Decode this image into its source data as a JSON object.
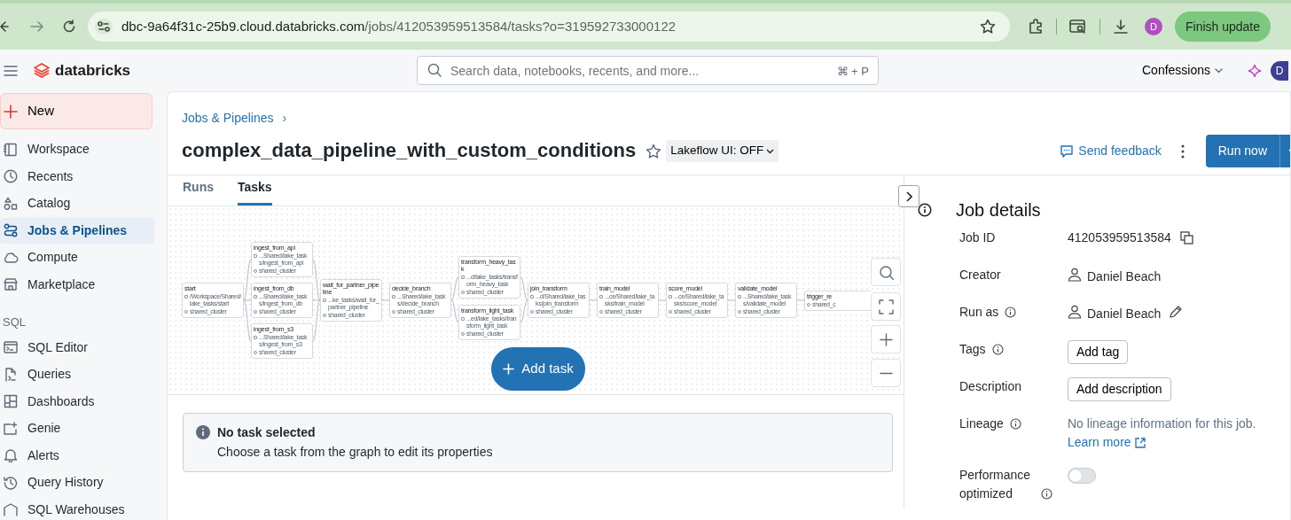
{
  "browser": {
    "url_host": "dbc-9a64f31c-25b9.cloud.databricks.com",
    "url_path": "/jobs/412053959513584/tasks?o=319592733000122",
    "profile_initial": "D",
    "update_button": "Finish update"
  },
  "header": {
    "brand": "databricks",
    "search_placeholder": "Search data, notebooks, recents, and more...",
    "shortcut": "⌘ + P",
    "workspace": "Confessions",
    "avatar_initial": "D"
  },
  "sidebar": {
    "new_button": "New",
    "items": [
      {
        "label": "Workspace",
        "selected": false
      },
      {
        "label": "Recents",
        "selected": false
      },
      {
        "label": "Catalog",
        "selected": false
      },
      {
        "label": "Jobs & Pipelines",
        "selected": true
      },
      {
        "label": "Compute",
        "selected": false
      },
      {
        "label": "Marketplace",
        "selected": false
      }
    ],
    "sql_heading": "SQL",
    "sql_items": [
      {
        "label": "SQL Editor",
        "selected": false
      },
      {
        "label": "Queries",
        "selected": false
      },
      {
        "label": "Dashboards",
        "selected": false
      },
      {
        "label": "Genie",
        "selected": false
      },
      {
        "label": "Alerts",
        "selected": false
      },
      {
        "label": "Query History",
        "selected": false
      },
      {
        "label": "SQL Warehouses",
        "selected": false
      }
    ]
  },
  "job": {
    "breadcrumb": "Jobs & Pipelines",
    "breadcrumb_sep": "›",
    "title": "complex_data_pipeline_with_custom_conditions",
    "lakeflow": "Lakeflow UI: OFF",
    "feedback": "Send feedback",
    "run_button": "Run now"
  },
  "tabs": [
    {
      "label": "Runs",
      "selected": false
    },
    {
      "label": "Tasks",
      "selected": true
    }
  ],
  "graph": {
    "nodes": [
      {
        "name": "start",
        "path": "/Workspace/Shared/lake_tasks/start",
        "cluster": "shared_cluster"
      },
      {
        "name": "ingest_from_api",
        "path": "...Shared/lake_tasks/ingest_from_api",
        "cluster": "shared_cluster"
      },
      {
        "name": "ingest_from_db",
        "path": "...Shared/lake_tasks/ingest_from_db",
        "cluster": "shared_cluster"
      },
      {
        "name": "ingest_from_s3",
        "path": "...Shared/lake_tasks/ingest_from_s3",
        "cluster": "shared_cluster"
      },
      {
        "name": "wait_for_partner_pipeline",
        "path": "...ke_tasks/wait_for_partner_pipeline",
        "cluster": "shared_cluster"
      },
      {
        "name": "decide_branch",
        "path": "...Shared/lake_tasks/decide_branch",
        "cluster": "shared_cluster"
      },
      {
        "name": "transform_heavy_task",
        "path": "...d/lake_tasks/transform_heavy_task",
        "cluster": "shared_cluster"
      },
      {
        "name": "transform_light_task",
        "path": "...ed/lake_tasks/transform_light_task",
        "cluster": "shared_cluster"
      },
      {
        "name": "join_transform",
        "path": "...d/Shared/lake_tasks/join_transform",
        "cluster": "shared_cluster"
      },
      {
        "name": "train_model",
        "path": "...ce/Shared/lake_tasks/train_model",
        "cluster": "shared_cluster"
      },
      {
        "name": "score_model",
        "path": "...ce/Shared/lake_tasks/score_model",
        "cluster": "shared_cluster"
      },
      {
        "name": "validate_model",
        "path": "...Shared/lake_tasks/validate_model",
        "cluster": "shared_cluster"
      },
      {
        "name": "trigger_re",
        "cluster": "shared_c"
      }
    ],
    "add_task": "Add task"
  },
  "notice": {
    "title": "No task selected",
    "text": "Choose a task from the graph to edit its properties"
  },
  "details": {
    "heading": "Job details",
    "rows": [
      {
        "kind": "id",
        "label": "Job ID",
        "info": false,
        "value": "412053959513584"
      },
      {
        "kind": "person",
        "label": "Creator",
        "info": false,
        "value": "Daniel Beach",
        "editable": false
      },
      {
        "kind": "person",
        "label": "Run as",
        "info": true,
        "value": "Daniel Beach",
        "editable": true
      },
      {
        "kind": "button",
        "label": "Tags",
        "info": true,
        "value": "Add tag"
      },
      {
        "kind": "button",
        "label": "Description",
        "info": false,
        "value": "Add description"
      },
      {
        "kind": "lineage",
        "label": "Lineage",
        "info": true,
        "value": "No lineage information for this job.",
        "link": "Learn more"
      },
      {
        "kind": "toggle",
        "label": "Performance optimized",
        "info": true,
        "on": false
      }
    ]
  }
}
